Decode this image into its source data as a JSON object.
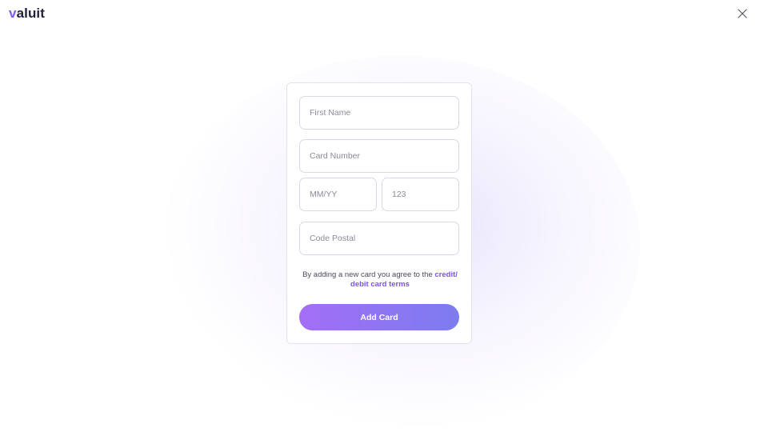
{
  "header": {
    "logo_mark": "v",
    "logo_rest": "aluit",
    "close_icon": "close-icon"
  },
  "form": {
    "first_name": {
      "placeholder": "First Name",
      "value": ""
    },
    "card_number": {
      "placeholder": "Card Number",
      "value": ""
    },
    "expiry": {
      "placeholder": "MM/YY",
      "value": ""
    },
    "cvc": {
      "placeholder": "123",
      "value": ""
    },
    "postal": {
      "placeholder": "Code Postal",
      "value": ""
    },
    "terms_text": "By adding a new card you agree to the ",
    "terms_link": "credit/ debit card terms",
    "submit_label": "Add Card"
  },
  "colors": {
    "accent": "#7a55e8",
    "button_gradient_start": "#a36ef5",
    "button_gradient_end": "#7c7cf0",
    "field_border": "#d9d9e3"
  }
}
